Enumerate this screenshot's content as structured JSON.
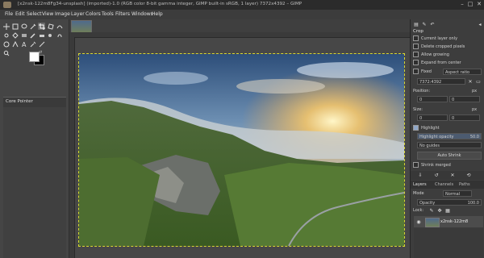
{
  "window": {
    "title": "[x2nsk-122m8Fg34-unsplash] (imported)-1.0 (RGB color 8-bit gamma integer, GIMP built-in sRGB, 1 layer) 7372x4392 – GIMP"
  },
  "menubar": [
    "File",
    "Edit",
    "Select",
    "View",
    "Image",
    "Layer",
    "Colors",
    "Tools",
    "Filters",
    "Windows",
    "Help"
  ],
  "tool_options": {
    "tab_label": "Crop"
  },
  "toolbox": {
    "options_tab_label": "Core Pointer"
  },
  "crop_options": {
    "current_layer_only": "Current layer only",
    "delete_cropped": "Delete cropped pixels",
    "allow_growing": "Allow growing",
    "expand_from_center": "Expand from center",
    "fixed_label": "Fixed",
    "fixed_value": "Aspect ratio",
    "ratio_value": "7372:4392",
    "position_label": "Position:",
    "position_unit": "px",
    "position_x": "0",
    "position_y": "0",
    "size_label": "Size:",
    "size_unit": "px",
    "size_w": "0",
    "size_h": "0",
    "highlight": "Highlight",
    "highlight_opacity_label": "Highlight opacity",
    "highlight_opacity_value": "50.0",
    "guides_value": "No guides",
    "auto_shrink": "Auto Shrink",
    "shrink_merged": "Shrink merged"
  },
  "layers_panel": {
    "tabs": [
      "Layers",
      "Channels",
      "Paths"
    ],
    "mode_label": "Mode",
    "mode_value": "Normal",
    "opacity_label": "Opacity",
    "opacity_value": "100.0",
    "lock_label": "Lock:",
    "layer_name": "x2nsk-122m8"
  }
}
